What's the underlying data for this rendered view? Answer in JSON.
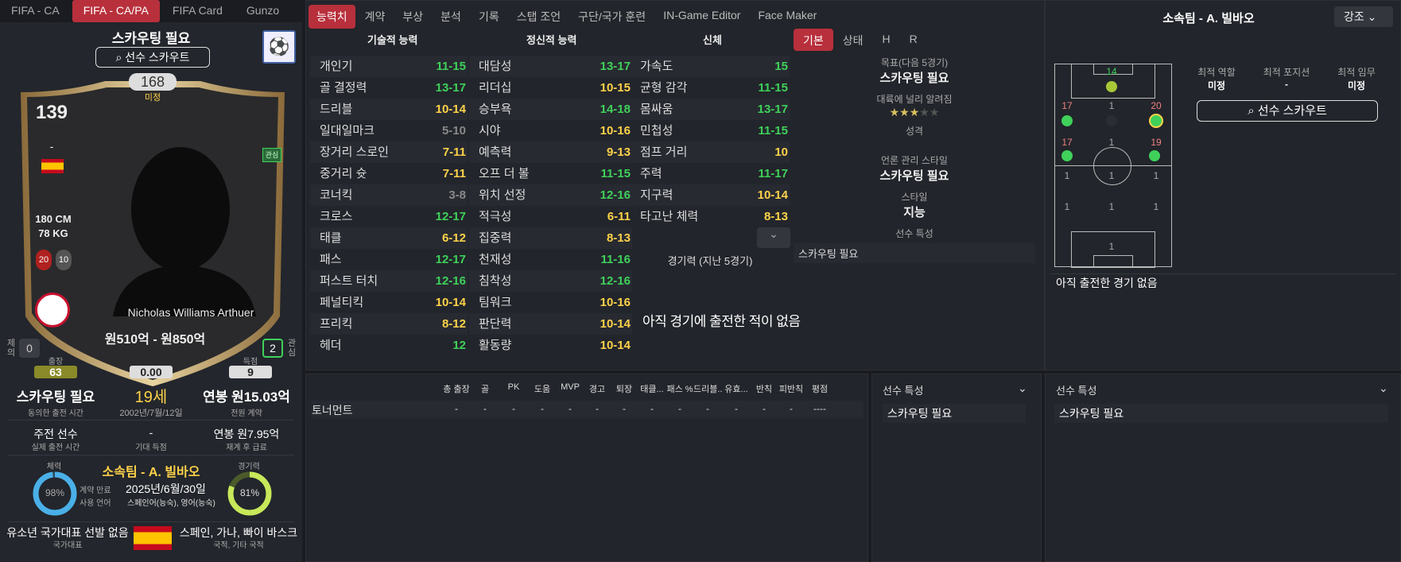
{
  "top_tabs": [
    "FIFA - CA",
    "FIFA - CA/PA",
    "FIFA Card",
    "Gunzo"
  ],
  "card": {
    "title": "스카우팅 필요",
    "scout_btn": "선수 스카우트",
    "rating": "168",
    "rating_label": "미정",
    "ovr": "139",
    "pos": "-",
    "height": "180 CM",
    "weight": "78 KG",
    "num1": "20",
    "num2": "10",
    "name": "Nicholas Williams Arthuer",
    "value": "원510억 - 원850억",
    "interest": "관심",
    "left_count": "0",
    "left_lbl": "제의",
    "right_count": "2",
    "right_lbl": "관심"
  },
  "stats_row": {
    "apps_lbl": "출장",
    "apps": "63",
    "rating": "0.00",
    "goals_lbl": "득점",
    "goals": "9"
  },
  "info1": {
    "a": "스카우팅 필요",
    "a_lbl": "동의한 출전 시간",
    "b": "19세",
    "b_lbl": "2002년/7월/12일",
    "c": "연봉 원15.03억",
    "c_lbl": "전원 계약"
  },
  "info2": {
    "a": "주전 선수",
    "a_lbl": "실제 출전 시간",
    "b": "-",
    "b_lbl": "기대 득점",
    "c": "연봉 원7.95억",
    "c_lbl": "재계 후 급료"
  },
  "club": {
    "name": "소속팀 - A. 빌바오",
    "cond_lbl": "체력",
    "cond": "98%",
    "contract_lbl": "계약 만료",
    "contract": "2025년/6월/30일",
    "lang_lbl": "사용 언어",
    "lang": "스페인어(능숙), 영어(능숙)",
    "fit_lbl": "경기력",
    "fit": "81%"
  },
  "nat": {
    "a": "유소년 국가대표 선발 없음",
    "a_lbl": "국가대표",
    "b": "스페인, 가나, 빠이 바스크",
    "b_lbl": "국적, 기타 국적"
  },
  "tabs": [
    "능력치",
    "계약",
    "부상",
    "분석",
    "기록",
    "스탭 조언",
    "구단/국가 훈련",
    "IN-Game Editor",
    "Face Maker"
  ],
  "headers": {
    "tech": "기술적 능력",
    "mental": "정신적 능력",
    "phys": "신체"
  },
  "tech": [
    [
      "개인기",
      "11-15",
      "g"
    ],
    [
      "골 결정력",
      "13-17",
      "g"
    ],
    [
      "드리블",
      "10-14",
      "y"
    ],
    [
      "일대일마크",
      "5-10",
      "gr"
    ],
    [
      "장거리 스로인",
      "7-11",
      "y"
    ],
    [
      "중거리 슛",
      "7-11",
      "y"
    ],
    [
      "코너킥",
      "3-8",
      "gr"
    ],
    [
      "크로스",
      "12-17",
      "g"
    ],
    [
      "태클",
      "6-12",
      "y"
    ],
    [
      "패스",
      "12-17",
      "g"
    ],
    [
      "퍼스트 터치",
      "12-16",
      "g"
    ],
    [
      "페널티킥",
      "10-14",
      "y"
    ],
    [
      "프리킥",
      "8-12",
      "y"
    ],
    [
      "헤더",
      "12",
      "g"
    ]
  ],
  "mental": [
    [
      "대담성",
      "13-17",
      "g"
    ],
    [
      "리더십",
      "10-15",
      "y"
    ],
    [
      "승부욕",
      "14-18",
      "g"
    ],
    [
      "시야",
      "10-16",
      "y"
    ],
    [
      "예측력",
      "9-13",
      "y"
    ],
    [
      "오프 더 볼",
      "11-15",
      "g"
    ],
    [
      "위치 선정",
      "12-16",
      "g"
    ],
    [
      "적극성",
      "6-11",
      "y"
    ],
    [
      "집중력",
      "8-13",
      "y"
    ],
    [
      "천재성",
      "11-16",
      "g"
    ],
    [
      "침착성",
      "12-16",
      "g"
    ],
    [
      "팀워크",
      "10-16",
      "y"
    ],
    [
      "판단력",
      "10-14",
      "y"
    ],
    [
      "활동량",
      "10-14",
      "y"
    ]
  ],
  "phys": [
    [
      "가속도",
      "15",
      "g"
    ],
    [
      "균형 감각",
      "11-15",
      "g"
    ],
    [
      "몸싸움",
      "13-17",
      "g"
    ],
    [
      "민첩성",
      "11-15",
      "g"
    ],
    [
      "점프 거리",
      "10",
      "y"
    ],
    [
      "주력",
      "11-17",
      "g"
    ],
    [
      "지구력",
      "10-14",
      "y"
    ],
    [
      "타고난 체력",
      "8-13",
      "y"
    ]
  ],
  "form": {
    "title": "경기력 (지난 5경기)",
    "none": "아직 경기에 출전한 적이 없음"
  },
  "subtabs": [
    "기본",
    "상태",
    "H",
    "R"
  ],
  "basic": {
    "goal_lbl": "목표(다음 5경기)",
    "goal": "스카우팅 필요",
    "rep_lbl": "대륙에 널리 알려짐",
    "person_lbl": "성격",
    "media_lbl": "언론 관리 스타일",
    "media": "스카우팅 필요",
    "style_lbl": "스타일",
    "style": "지능",
    "traits_lbl": "선수 특성",
    "traits": "스카우팅 필요"
  },
  "stats_table": {
    "headers": [
      "총 출장",
      "골",
      "PK",
      "도움",
      "MVP",
      "경고",
      "퇴장",
      "태클...",
      "패스 %",
      "드리블...",
      "유효...",
      "반칙",
      "피반칙",
      "평점"
    ],
    "row_label": "토너먼트",
    "values": [
      "-",
      "-",
      "-",
      "-",
      "-",
      "-",
      "-",
      "-",
      "-",
      "-",
      "-",
      "-",
      "-",
      "----"
    ]
  },
  "traits1": {
    "title": "선수 특성",
    "value": "스카우팅 필요"
  },
  "traits2": {
    "title": "선수 특성",
    "value": "스카우팅 필요"
  },
  "right": {
    "title": "소속팀 - A. 빌바오",
    "dropdown": "강조",
    "best_role_lbl": "최적 역할",
    "best_role": "미정",
    "best_pos_lbl": "최적 포지션",
    "best_pos": "-",
    "best_duty_lbl": "최적 임무",
    "best_duty": "미정",
    "scout_btn": "선수 스카우트",
    "no_games": "아직 출전한 경기 없음"
  },
  "pitch": {
    "gk": "14",
    "l1": "17",
    "c1": "1",
    "r1": "20",
    "l2": "17",
    "c2": "1",
    "r2": "19",
    "a": "1",
    "b": "1",
    "c": "1",
    "d": "1",
    "e": "1",
    "f": "1",
    "st": "1"
  },
  "colors": {
    "accent": "#b8303c",
    "green": "#3fd15a",
    "yellow": "#ffd24a"
  }
}
